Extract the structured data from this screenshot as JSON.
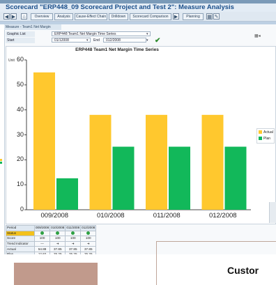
{
  "window": {
    "title": "Scorecard \"ERP448_09 Scorecard Project and Test 2\": Measure Analysis"
  },
  "toolbar": {
    "buttons": [
      "Overview",
      "Analysis",
      "Cause-Effect Chain",
      "Drilldown",
      "Scorecard Comparison",
      "Planning"
    ]
  },
  "panel": {
    "title": "Measure - Team1 Net Margin",
    "graphic_list_label": "Graphic List",
    "graphic_list_value": "ERP448 Team1 Net Margin Time Series",
    "start_label": "Start",
    "start_value": "01/12008",
    "end_label": "End",
    "end_value": "012/2008"
  },
  "chart_data": {
    "type": "bar",
    "title": "ERP448 Team1 Net Margin Time Series",
    "unit_label": "Unit",
    "categories": [
      "009/2008",
      "010/2008",
      "011/2008",
      "012/2008"
    ],
    "series": [
      {
        "name": "Actual",
        "color": "#ffc82e",
        "values": [
          55,
          38,
          38,
          38
        ]
      },
      {
        "name": "Plan",
        "color": "#12b85a",
        "values": [
          12.6,
          25.25,
          25.25,
          25.25
        ]
      }
    ],
    "ylim": [
      0,
      60
    ],
    "yticks": [
      0,
      10,
      20,
      30,
      40,
      50,
      60
    ],
    "grid": false,
    "legend_position": "right"
  },
  "kpi_table": {
    "header": [
      "Period",
      "009/2008",
      "010/2008",
      "011/2008",
      "012/2008"
    ],
    "rows": [
      {
        "label": "Status",
        "values": [
          "",
          "",
          "",
          ""
        ]
      },
      {
        "label": "Score",
        "values": [
          "100",
          "100",
          "100",
          "100"
        ]
      },
      {
        "label": "Trend Indicator",
        "values": [
          "",
          "",
          "",
          ""
        ]
      },
      {
        "label": "Actual",
        "values": [
          "54.88",
          "37.85",
          "37.85",
          "37.85"
        ]
      },
      {
        "label": "Plan",
        "values": [
          "12.62",
          "25.25",
          "25.25",
          "25.25"
        ]
      }
    ]
  },
  "overlay": {
    "text": "Custor"
  }
}
